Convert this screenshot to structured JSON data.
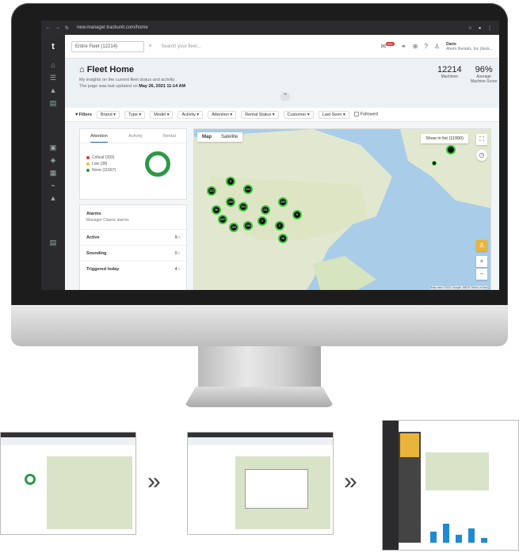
{
  "browser": {
    "url": "new.manager.trackunit.com/home"
  },
  "topbar": {
    "fleet_select": "Entire Fleet (12214)",
    "search_placeholder": "Search your fleet...",
    "notif_badge": "99+",
    "user_name": "Dario",
    "user_org": "Ahern Rentals, Inc (desk..."
  },
  "header": {
    "title": "Fleet Home",
    "subtitle": "My insights on the current fleet status and activity.",
    "updated_prefix": "The page was last updated on",
    "updated_date": "May 26, 2021 11:14 AM",
    "machines_value": "12214",
    "machines_label": "Machines",
    "score_value": "96%",
    "score_label1": "Average",
    "score_label2": "Machine Score"
  },
  "filters": {
    "label": "Filters",
    "items": [
      "Brand",
      "Type",
      "Model",
      "Activity",
      "Attention",
      "Rental Status",
      "Customer",
      "Last Seen"
    ],
    "followed": "Followed"
  },
  "attention": {
    "tabs": [
      "Attention",
      "Activity",
      "Rental"
    ],
    "legend": [
      {
        "label": "Critical (393)",
        "color": "#d33a2f"
      },
      {
        "label": "Low (38)",
        "color": "#e8c32b"
      },
      {
        "label": "None (11667)",
        "color": "#2a9a44"
      }
    ]
  },
  "alarms": {
    "title": "Alarms",
    "subtitle": "Manager Classic alarms",
    "rows": [
      {
        "label": "Active",
        "count": "9"
      },
      {
        "label": "Sounding",
        "count": "0"
      },
      {
        "label": "Triggered today",
        "count": "4"
      }
    ]
  },
  "map": {
    "tabs": [
      "Map",
      "Satellite"
    ],
    "show_list": "Show in list (11990)",
    "attribution": "Map data ©2021 Google, INEGI   Terms of Use",
    "clusters": [
      "323",
      "3",
      "104",
      "240",
      "324",
      "411",
      "243",
      "2",
      "36",
      "1027",
      "134",
      "106",
      "6",
      "2",
      "16"
    ]
  }
}
